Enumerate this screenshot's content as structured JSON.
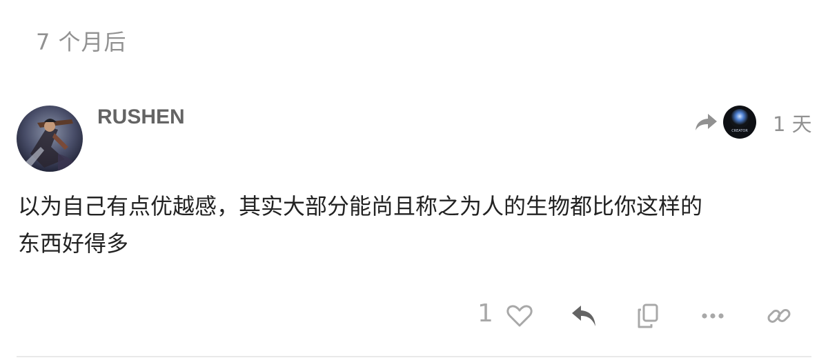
{
  "time_gap_label": "7 个月后",
  "post": {
    "username": "RUSHEN",
    "reply_to_avatar_text": "CREATOR",
    "date": "1 天",
    "body_line1": "以为自己有点优越感，其实大部分能尚且称之为人的生物都比你这样的",
    "body_line2": "东西好得多"
  },
  "actions": {
    "like_count": "1",
    "icons": [
      "heart-icon",
      "reply-icon",
      "copy-icon",
      "more-icon",
      "link-icon"
    ]
  },
  "colors": {
    "muted_text": "#919191",
    "username": "#646464",
    "body_text": "#222222",
    "icon": "#a8a8a8",
    "icon_dark": "#646464"
  }
}
